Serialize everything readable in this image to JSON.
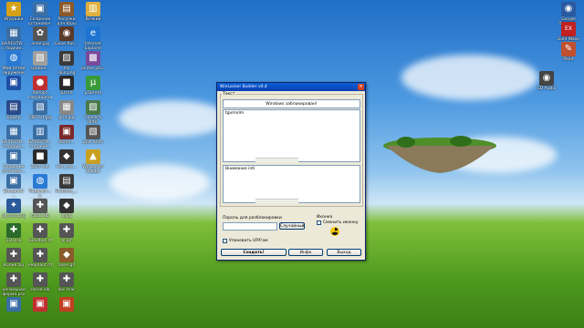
{
  "desktop": {
    "icons_left": [
      {
        "label": "Игрушки",
        "glyph": "★",
        "color": "#d4a017"
      },
      {
        "label": "Создание установоч...",
        "glyph": "▣",
        "color": "#3a6ea5"
      },
      {
        "label": "Рисунки для Юры",
        "glyph": "▤",
        "color": "#8b5a2b"
      },
      {
        "label": "Всякий",
        "glyph": "▥",
        "color": "#e0b040"
      },
      {
        "label": "ВАЛЕНТИ... с подкин...",
        "glyph": "▦",
        "color": "#3a6ea5"
      },
      {
        "label": "anne.jpg",
        "glyph": "✿",
        "color": "#555"
      },
      {
        "label": "Gone-Ros...",
        "glyph": "◉",
        "color": "#5a3a2a"
      },
      {
        "label": "Internet Explorer",
        "glyph": "e",
        "color": "#1e74d0"
      },
      {
        "label": "Мои сетей окружени",
        "glyph": "◍",
        "color": "#2a7ad4"
      },
      {
        "label": "sqtabel...",
        "glyph": "▧",
        "color": "#a0a0a0"
      },
      {
        "label": "my skin.png",
        "glyph": "▨",
        "color": "#3a3a3a"
      },
      {
        "label": "anime_ptu...",
        "glyph": "▩",
        "color": "#7a4a9a"
      },
      {
        "label": "",
        "glyph": "▣",
        "color": "#1e4fa5"
      },
      {
        "label": "Рапорт сокращения",
        "glyph": "●",
        "color": "#c03030"
      },
      {
        "label": "Штоп",
        "glyph": "■",
        "color": "#2a2a2a"
      },
      {
        "label": "µTorrent",
        "glyph": "µ",
        "color": "#3a9a3a"
      },
      {
        "label": "Буфер",
        "glyph": "▤",
        "color": "#2a4a8a"
      },
      {
        "label": "СВП.txt.jpg",
        "glyph": "▧",
        "color": "#3a6ea5"
      },
      {
        "label": "grid.jpg",
        "glyph": "▦",
        "color": "#888"
      },
      {
        "label": "Скачать ПРОГ",
        "glyph": "▨",
        "color": "#4a7a4a"
      },
      {
        "label": "ВАЛЕНТИ... с подкин...",
        "glyph": "▦",
        "color": "#3a6ea5"
      },
      {
        "label": "ВАЛЕНТИ... с подкин...",
        "glyph": "▥",
        "color": "#3a6ea5"
      },
      {
        "label": "Roron...",
        "glyph": "▣",
        "color": "#7a2a2a"
      },
      {
        "label": "Zbis Anim",
        "glyph": "▧",
        "color": "#555"
      },
      {
        "label": "Создание установо...",
        "glyph": "▣",
        "color": "#3a6ea5"
      },
      {
        "label": "Zbis Анк",
        "glyph": "■",
        "color": "#2a2a2a"
      },
      {
        "label": "Hon_rec...",
        "glyph": "◆",
        "color": "#333"
      },
      {
        "label": "WinLocker Builder v0.4",
        "glyph": "▲",
        "color": "#c8a020"
      },
      {
        "label": "Внешний ...",
        "glyph": "▣",
        "color": "#3a6ea5"
      },
      {
        "label": "Подключ... к интерне...",
        "glyph": "◍",
        "color": "#2a7ad4"
      },
      {
        "label": "Hudshot_...",
        "glyph": "▤",
        "color": "#3a3a3a"
      },
      {
        "label": "",
        "glyph": "",
        "color": "transparent"
      },
      {
        "label": "all_icon.png",
        "glyph": "✦",
        "color": "#2a5a9a"
      },
      {
        "label": "clock.xlb",
        "glyph": "✚",
        "color": "#555"
      },
      {
        "label": "a.jpg",
        "glyph": "◆",
        "color": "#333"
      },
      {
        "label": "",
        "glyph": "",
        "color": "transparent"
      },
      {
        "label": "1D.xlsx",
        "glyph": "✚",
        "color": "#2a6a2a"
      },
      {
        "label": "Goodbye.rtf",
        "glyph": "✚",
        "color": "#555"
      },
      {
        "label": "ol.gif",
        "glyph": "✚",
        "color": "#555"
      },
      {
        "label": "",
        "glyph": "",
        "color": "transparent"
      },
      {
        "label": "Копия.zip",
        "glyph": "✚",
        "color": "#555"
      },
      {
        "label": "elephant.rtf",
        "glyph": "✚",
        "color": "#555"
      },
      {
        "label": "anne.gif",
        "glyph": "◆",
        "color": "#8a5a2a"
      },
      {
        "label": "",
        "glyph": "",
        "color": "transparent"
      },
      {
        "label": "начальная форма.psx",
        "glyph": "✚",
        "color": "#555"
      },
      {
        "label": "Horse.xlb",
        "glyph": "✚",
        "color": "#555"
      },
      {
        "label": "doc.mac",
        "glyph": "✚",
        "color": "#555"
      },
      {
        "label": "",
        "glyph": "",
        "color": "transparent"
      },
      {
        "label": "",
        "glyph": "▣",
        "color": "#3a6ea5"
      },
      {
        "label": "",
        "glyph": "▣",
        "color": "#c03030"
      },
      {
        "label": "",
        "glyph": "▣",
        "color": "#c04020"
      }
    ],
    "icons_right": [
      {
        "label": "Google Планет...",
        "glyph": "◉",
        "color": "#2a5aa0"
      },
      {
        "label": "Gold Wave 5.25",
        "glyph": "EX",
        "color": "#c02020"
      },
      {
        "label": "Paint",
        "glyph": "✎",
        "color": "#c05030"
      },
      {
        "label": "CD Audio",
        "glyph": "◉",
        "color": "#444"
      }
    ]
  },
  "window": {
    "title": "WinLocker Builder v0.4",
    "text_group_label": "Текст",
    "header_field": "Windows заблокирован!",
    "body_field": "tgvmnlm",
    "footer_field": "Внимание inti",
    "password_label": "Пароль для разблокировки",
    "random_button": "Случайный",
    "icon_label": "Иконка",
    "change_icon_checkbox": "Сменить иконку",
    "upx_checkbox": "Упаковать UPX'ом",
    "create_button": "Создать!",
    "info_button": "Инфо",
    "exit_button": "Выход"
  },
  "colors": {
    "titlebar": "#0a4fc8",
    "radiation_icon": "#f4c400"
  }
}
